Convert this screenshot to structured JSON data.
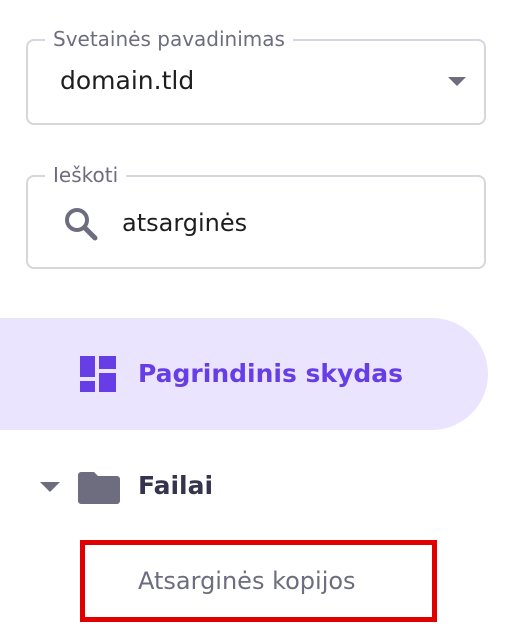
{
  "domain_select": {
    "label": "Svetainės pavadinimas",
    "value": "domain.tld"
  },
  "search": {
    "label": "Ieškoti",
    "value": "atsarginės"
  },
  "nav": {
    "dashboard_label": "Pagrindinis skydas",
    "files_label": "Failai",
    "backups_label": "Atsarginės kopijos"
  },
  "colors": {
    "accent": "#673de6",
    "active_background": "#ebe4ff",
    "highlight_border": "#e00000",
    "icon_gray": "#6d6d7f"
  },
  "icons": {
    "dropdown": "chevron-down-icon",
    "search": "search-icon",
    "dashboard": "dashboard-grid-icon",
    "files_toggle": "caret-down-icon",
    "files": "folder-icon"
  }
}
